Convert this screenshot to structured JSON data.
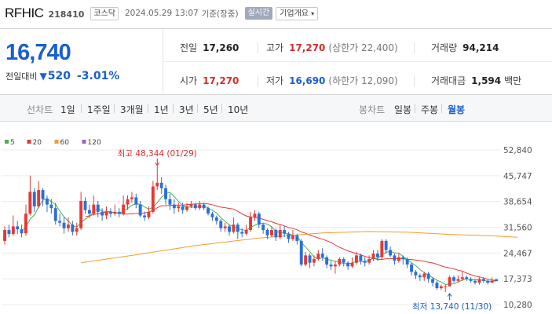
{
  "header": {
    "name": "RFHIC",
    "code": "218410",
    "market": "코스닥",
    "datetime": "2024.05.29 13:07",
    "basis": "기준(장중)",
    "live_label": "실시간",
    "overview_label": "기업개요",
    "overview_icon": "caret-down-icon"
  },
  "quote": {
    "price": "16,740",
    "change_label": "전일대비",
    "change_icon": "down-triangle",
    "change_value": "520",
    "change_pct": "-3.01%",
    "prev_close_label": "전일",
    "prev_close": "17,260",
    "high_label": "고가",
    "high": "17,270",
    "upper_limit": "(상한가 22,400)",
    "volume_label": "거래량",
    "volume": "94,214",
    "open_label": "시가",
    "open": "17,270",
    "low_label": "저가",
    "low": "16,690",
    "lower_limit": "(하한가 12,090)",
    "amount_label": "거래대금",
    "amount": "1,594",
    "amount_unit": "백만",
    "colors": {
      "up": "#d42e2e",
      "down": "#1a5ecf"
    }
  },
  "tabs": {
    "line_head": "선차트",
    "line": [
      "1일",
      "1주일",
      "3개월",
      "1년",
      "3년",
      "5년",
      "10년"
    ],
    "candle_head": "봉차트",
    "candle": [
      "일봉",
      "주봉",
      "월봉"
    ],
    "candle_active": 2
  },
  "chart_data": {
    "type": "candlestick",
    "legend": [
      {
        "name": "5",
        "color": "#4caf50"
      },
      {
        "name": "20",
        "color": "#e53935"
      },
      {
        "name": "60",
        "color": "#f39c2b"
      },
      {
        "name": "120",
        "color": "#a15cc6"
      }
    ],
    "y_ticks": [
      "52,840",
      "45,747",
      "38,654",
      "31,560",
      "24,467",
      "17,373",
      "10,280"
    ],
    "ylim": [
      10280,
      52840
    ],
    "grid": true,
    "up_color": "#e53935",
    "down_color": "#2b6fd6",
    "annotation_max": {
      "text": "최고 48,344 (01/29)",
      "value": 48344,
      "index": 36
    },
    "annotation_min": {
      "text": "최저 13,740 (11/30)",
      "value": 13740,
      "index": 105
    },
    "candles": [
      {
        "o": 27800,
        "c": 30800,
        "h": 31800,
        "l": 26800
      },
      {
        "o": 30800,
        "c": 29700,
        "h": 32300,
        "l": 28800
      },
      {
        "o": 29700,
        "c": 31800,
        "h": 34800,
        "l": 29200
      },
      {
        "o": 31800,
        "c": 31000,
        "h": 33300,
        "l": 29700
      },
      {
        "o": 31000,
        "c": 29900,
        "h": 32300,
        "l": 28800
      },
      {
        "o": 29900,
        "c": 35300,
        "h": 37800,
        "l": 29200
      },
      {
        "o": 35300,
        "c": 41300,
        "h": 45800,
        "l": 34800
      },
      {
        "o": 41300,
        "c": 37300,
        "h": 42300,
        "l": 35800
      },
      {
        "o": 37300,
        "c": 41800,
        "h": 44300,
        "l": 36800
      },
      {
        "o": 41800,
        "c": 39300,
        "h": 42300,
        "l": 37300
      },
      {
        "o": 39300,
        "c": 37800,
        "h": 40300,
        "l": 35800
      },
      {
        "o": 37800,
        "c": 36800,
        "h": 39300,
        "l": 35300
      },
      {
        "o": 36800,
        "c": 33300,
        "h": 38300,
        "l": 32300
      },
      {
        "o": 33300,
        "c": 32800,
        "h": 35300,
        "l": 31800
      },
      {
        "o": 32800,
        "c": 31300,
        "h": 34300,
        "l": 29800
      },
      {
        "o": 31300,
        "c": 32300,
        "h": 34300,
        "l": 30300
      },
      {
        "o": 32300,
        "c": 30300,
        "h": 33300,
        "l": 29300
      },
      {
        "o": 30300,
        "c": 31300,
        "h": 32800,
        "l": 29300
      },
      {
        "o": 31300,
        "c": 38800,
        "h": 41300,
        "l": 30800
      },
      {
        "o": 38800,
        "c": 36300,
        "h": 39800,
        "l": 35300
      },
      {
        "o": 36300,
        "c": 35300,
        "h": 37800,
        "l": 34300
      },
      {
        "o": 35300,
        "c": 37800,
        "h": 40300,
        "l": 34800
      },
      {
        "o": 37800,
        "c": 35800,
        "h": 38800,
        "l": 34300
      },
      {
        "o": 35800,
        "c": 34800,
        "h": 36800,
        "l": 33300
      },
      {
        "o": 34800,
        "c": 35800,
        "h": 37300,
        "l": 33800
      },
      {
        "o": 35800,
        "c": 35300,
        "h": 36800,
        "l": 34300
      },
      {
        "o": 35300,
        "c": 35800,
        "h": 37800,
        "l": 34800
      },
      {
        "o": 35800,
        "c": 35300,
        "h": 36800,
        "l": 34300
      },
      {
        "o": 35300,
        "c": 37800,
        "h": 40300,
        "l": 34800
      },
      {
        "o": 37800,
        "c": 39300,
        "h": 40300,
        "l": 36300
      },
      {
        "o": 39300,
        "c": 39800,
        "h": 41300,
        "l": 38300
      },
      {
        "o": 39800,
        "c": 37800,
        "h": 40800,
        "l": 36800
      },
      {
        "o": 37800,
        "c": 34800,
        "h": 38800,
        "l": 34300
      },
      {
        "o": 34800,
        "c": 34300,
        "h": 35800,
        "l": 33300
      },
      {
        "o": 34300,
        "c": 35800,
        "h": 37300,
        "l": 33800
      },
      {
        "o": 35800,
        "c": 42800,
        "h": 44300,
        "l": 35300
      },
      {
        "o": 42800,
        "c": 43800,
        "h": 48344,
        "l": 41800
      },
      {
        "o": 43800,
        "c": 42300,
        "h": 45300,
        "l": 40800
      },
      {
        "o": 42300,
        "c": 39300,
        "h": 43300,
        "l": 37800
      },
      {
        "o": 39300,
        "c": 37800,
        "h": 40800,
        "l": 36300
      },
      {
        "o": 37800,
        "c": 36800,
        "h": 39300,
        "l": 35300
      },
      {
        "o": 36800,
        "c": 37300,
        "h": 38300,
        "l": 35800
      },
      {
        "o": 37300,
        "c": 36300,
        "h": 38300,
        "l": 35300
      },
      {
        "o": 36300,
        "c": 37300,
        "h": 38300,
        "l": 35800
      },
      {
        "o": 37300,
        "c": 37800,
        "h": 38800,
        "l": 36800
      },
      {
        "o": 37800,
        "c": 36800,
        "h": 38300,
        "l": 36300
      },
      {
        "o": 36800,
        "c": 37800,
        "h": 38800,
        "l": 36300
      },
      {
        "o": 37800,
        "c": 36800,
        "h": 38300,
        "l": 36300
      },
      {
        "o": 36800,
        "c": 35300,
        "h": 37300,
        "l": 34800
      },
      {
        "o": 35300,
        "c": 34300,
        "h": 35800,
        "l": 33300
      },
      {
        "o": 34300,
        "c": 33300,
        "h": 34800,
        "l": 32300
      },
      {
        "o": 33300,
        "c": 31300,
        "h": 33800,
        "l": 30300
      },
      {
        "o": 31300,
        "c": 31800,
        "h": 32800,
        "l": 30300
      },
      {
        "o": 31800,
        "c": 30300,
        "h": 32300,
        "l": 29300
      },
      {
        "o": 30300,
        "c": 32300,
        "h": 34300,
        "l": 29800
      },
      {
        "o": 32300,
        "c": 30300,
        "h": 32800,
        "l": 28300
      },
      {
        "o": 30300,
        "c": 29800,
        "h": 31300,
        "l": 28800
      },
      {
        "o": 29800,
        "c": 30800,
        "h": 32300,
        "l": 29300
      },
      {
        "o": 30800,
        "c": 34300,
        "h": 35800,
        "l": 30300
      },
      {
        "o": 34300,
        "c": 35300,
        "h": 36300,
        "l": 33300
      },
      {
        "o": 35300,
        "c": 32300,
        "h": 35800,
        "l": 31300
      },
      {
        "o": 32300,
        "c": 30800,
        "h": 32800,
        "l": 29800
      },
      {
        "o": 30800,
        "c": 29300,
        "h": 31300,
        "l": 28300
      },
      {
        "o": 29300,
        "c": 30800,
        "h": 31800,
        "l": 28800
      },
      {
        "o": 30800,
        "c": 28800,
        "h": 31300,
        "l": 27800
      },
      {
        "o": 28800,
        "c": 30800,
        "h": 32300,
        "l": 28300
      },
      {
        "o": 30800,
        "c": 29800,
        "h": 31800,
        "l": 28800
      },
      {
        "o": 29800,
        "c": 28300,
        "h": 30300,
        "l": 27300
      },
      {
        "o": 28300,
        "c": 29300,
        "h": 30800,
        "l": 27800
      },
      {
        "o": 29300,
        "c": 27800,
        "h": 29800,
        "l": 26800
      },
      {
        "o": 27800,
        "c": 21300,
        "h": 28300,
        "l": 20800
      },
      {
        "o": 21300,
        "c": 23800,
        "h": 24800,
        "l": 20800
      },
      {
        "o": 23800,
        "c": 21800,
        "h": 24300,
        "l": 20300
      },
      {
        "o": 21800,
        "c": 22800,
        "h": 23800,
        "l": 20800
      },
      {
        "o": 22800,
        "c": 24300,
        "h": 25300,
        "l": 22300
      },
      {
        "o": 24300,
        "c": 23300,
        "h": 25800,
        "l": 22300
      },
      {
        "o": 23300,
        "c": 21300,
        "h": 23800,
        "l": 20300
      },
      {
        "o": 21300,
        "c": 20800,
        "h": 22300,
        "l": 19800
      },
      {
        "o": 20800,
        "c": 21300,
        "h": 22300,
        "l": 18800
      },
      {
        "o": 21300,
        "c": 22800,
        "h": 23300,
        "l": 20800
      },
      {
        "o": 22800,
        "c": 21800,
        "h": 23300,
        "l": 20800
      },
      {
        "o": 21800,
        "c": 20800,
        "h": 22300,
        "l": 19800
      },
      {
        "o": 20800,
        "c": 21800,
        "h": 23300,
        "l": 20300
      },
      {
        "o": 21800,
        "c": 23800,
        "h": 24800,
        "l": 21300
      },
      {
        "o": 23800,
        "c": 22300,
        "h": 24300,
        "l": 21300
      },
      {
        "o": 22300,
        "c": 21800,
        "h": 23300,
        "l": 20800
      },
      {
        "o": 21800,
        "c": 22800,
        "h": 23800,
        "l": 21300
      },
      {
        "o": 22800,
        "c": 24300,
        "h": 25300,
        "l": 22300
      },
      {
        "o": 24300,
        "c": 23300,
        "h": 25300,
        "l": 22300
      },
      {
        "o": 23300,
        "c": 27800,
        "h": 28300,
        "l": 22800
      },
      {
        "o": 27800,
        "c": 25300,
        "h": 28300,
        "l": 24300
      },
      {
        "o": 25300,
        "c": 23800,
        "h": 26300,
        "l": 23300
      },
      {
        "o": 23800,
        "c": 22300,
        "h": 24300,
        "l": 21300
      },
      {
        "o": 22300,
        "c": 23300,
        "h": 24300,
        "l": 21800
      },
      {
        "o": 23300,
        "c": 22800,
        "h": 23800,
        "l": 21300
      },
      {
        "o": 22800,
        "c": 21300,
        "h": 23300,
        "l": 20300
      },
      {
        "o": 21300,
        "c": 19300,
        "h": 21800,
        "l": 18300
      },
      {
        "o": 19300,
        "c": 18300,
        "h": 19800,
        "l": 17300
      },
      {
        "o": 18300,
        "c": 17800,
        "h": 18800,
        "l": 16800
      },
      {
        "o": 17800,
        "c": 18800,
        "h": 19300,
        "l": 16800
      },
      {
        "o": 18800,
        "c": 17300,
        "h": 19300,
        "l": 16300
      },
      {
        "o": 17300,
        "c": 16300,
        "h": 17800,
        "l": 15300
      },
      {
        "o": 16300,
        "c": 14800,
        "h": 16800,
        "l": 14300
      },
      {
        "o": 14800,
        "c": 15300,
        "h": 15800,
        "l": 14300
      },
      {
        "o": 15300,
        "c": 15300,
        "h": 15800,
        "l": 13740
      },
      {
        "o": 15300,
        "c": 17800,
        "h": 18300,
        "l": 15300
      },
      {
        "o": 17800,
        "c": 16800,
        "h": 18300,
        "l": 16300
      },
      {
        "o": 16800,
        "c": 17300,
        "h": 18300,
        "l": 16300
      },
      {
        "o": 17300,
        "c": 17800,
        "h": 19300,
        "l": 16800
      },
      {
        "o": 17800,
        "c": 17300,
        "h": 18300,
        "l": 16800
      },
      {
        "o": 17300,
        "c": 16800,
        "h": 17800,
        "l": 16300
      },
      {
        "o": 16800,
        "c": 16300,
        "h": 17300,
        "l": 15800
      },
      {
        "o": 16300,
        "c": 17300,
        "h": 17800,
        "l": 15800
      },
      {
        "o": 17300,
        "c": 16800,
        "h": 17800,
        "l": 16300
      },
      {
        "o": 16800,
        "c": 16300,
        "h": 17300,
        "l": 15800
      },
      {
        "o": 16300,
        "c": 16800,
        "h": 17800,
        "l": 16300
      },
      {
        "o": 17260,
        "c": 16740,
        "h": 17270,
        "l": 16690
      }
    ],
    "ma60": [
      {
        "i": 18,
        "v": 21800
      },
      {
        "i": 30,
        "v": 23800
      },
      {
        "i": 45,
        "v": 26500
      },
      {
        "i": 60,
        "v": 28600
      },
      {
        "i": 75,
        "v": 30000
      },
      {
        "i": 86,
        "v": 30400
      },
      {
        "i": 95,
        "v": 30200
      },
      {
        "i": 105,
        "v": 29600
      },
      {
        "i": 115,
        "v": 29200
      },
      {
        "i": 121,
        "v": 28800
      }
    ]
  }
}
